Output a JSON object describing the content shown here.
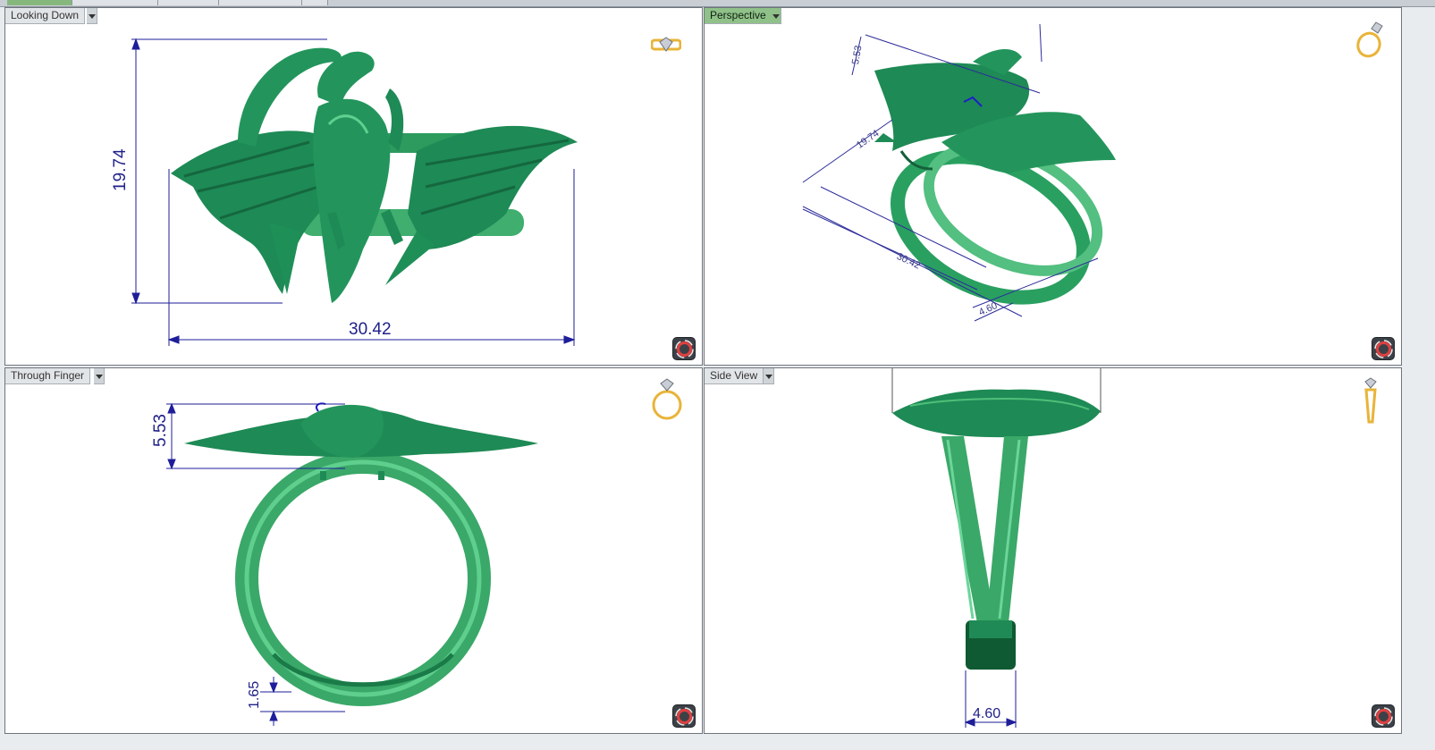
{
  "viewports": {
    "looking_down": {
      "label": "Looking Down",
      "dim_height": "19.74",
      "dim_width": "30.42"
    },
    "perspective": {
      "label": "Perspective",
      "dim_a": "5.53",
      "dim_b": "19.74",
      "dim_c": "30.42",
      "dim_d": "4.60"
    },
    "through_finger": {
      "label": "Through Finger",
      "dim_top": "5.53",
      "dim_band": "1.65"
    },
    "side_view": {
      "label": "Side View",
      "dim_width": "4.60"
    }
  },
  "colors": {
    "model": "#1f8a55",
    "model_light": "#4fbf7a",
    "dimension": "#1e1e9a",
    "active_tab": "#8fc189",
    "icon_gold": "#e8b43a"
  },
  "icons": [
    "ring-top-icon",
    "ring-perspective-icon",
    "ring-front-icon",
    "ring-side-icon",
    "rotate-icon"
  ]
}
